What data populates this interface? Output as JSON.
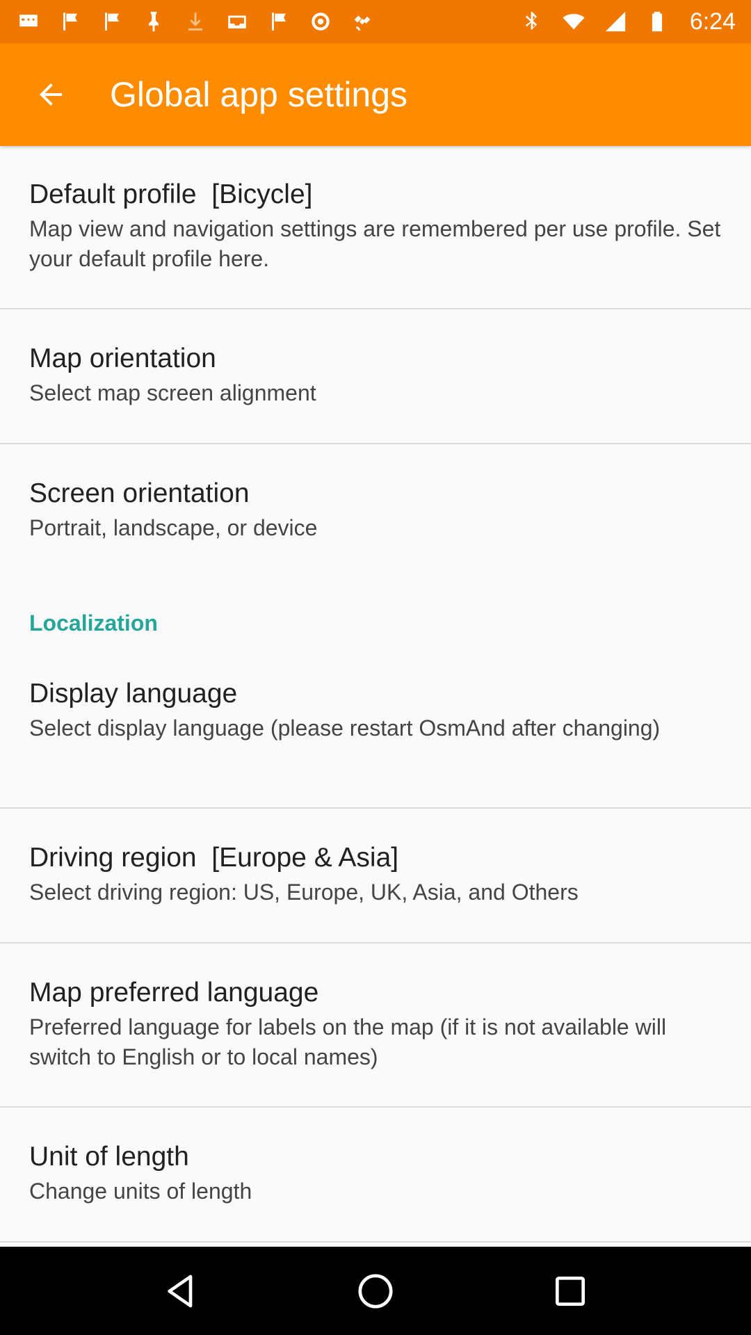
{
  "status_bar": {
    "time": "6:24",
    "left_icons": [
      "message-icon",
      "flag-icon",
      "flag-icon",
      "pushpin-icon",
      "download-icon",
      "inbox-icon",
      "flag-icon",
      "settings-dot-icon",
      "fake-gps-icon"
    ],
    "right_icons": [
      "bluetooth-icon",
      "wifi-icon",
      "signal-icon",
      "battery-icon"
    ]
  },
  "app_bar": {
    "title": "Global app settings",
    "back_icon": "arrow-back-icon"
  },
  "settings": {
    "default_profile": {
      "title": "Default profile  [Bicycle]",
      "summary": "Map view and navigation settings are remembered per use profile. Set your default profile here."
    },
    "map_orientation": {
      "title": "Map orientation",
      "summary": "Select map screen alignment"
    },
    "screen_orientation": {
      "title": "Screen orientation",
      "summary": "Portrait, landscape, or device"
    },
    "localization_header": "Localization",
    "display_language": {
      "title": "Display language",
      "summary": "Select display language (please restart OsmAnd after changing)"
    },
    "driving_region": {
      "title": "Driving region  [Europe & Asia]",
      "summary": "Select driving region: US, Europe, UK, Asia, and Others"
    },
    "map_preferred_language": {
      "title": "Map preferred language",
      "summary": "Preferred language for labels on the map (if it is not available will switch to English or to local names)"
    },
    "unit_of_length": {
      "title": "Unit of length",
      "summary": "Change units of length"
    }
  },
  "colors": {
    "status_bar": "#f07800",
    "app_bar": "#ff8c00",
    "category_accent": "#26a69a",
    "background": "#fafafa"
  },
  "nav_bar": {
    "icons": [
      "back-triangle-icon",
      "home-circle-icon",
      "recents-square-icon"
    ]
  }
}
